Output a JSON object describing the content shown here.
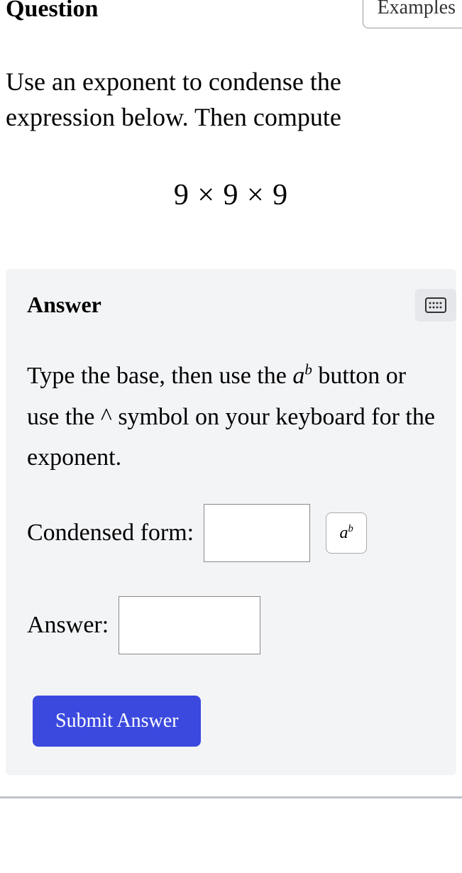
{
  "header": {
    "title": "Question",
    "examples_label": "Examples"
  },
  "prompt": "Use an exponent to condense the\nexpression below. Then compute",
  "expression": "9 × 9 × 9",
  "answer": {
    "title": "Answer",
    "instructions_pre": "Type the base, then use the ",
    "instructions_post": " button or use the ^ symbol on your keyboard for the exponent.",
    "condensed_label": "Condensed form:",
    "answer_label": "Answer:",
    "submit_label": "Submit Answer"
  },
  "icons": {
    "exponent_base": "a",
    "exponent_sup": "b"
  }
}
